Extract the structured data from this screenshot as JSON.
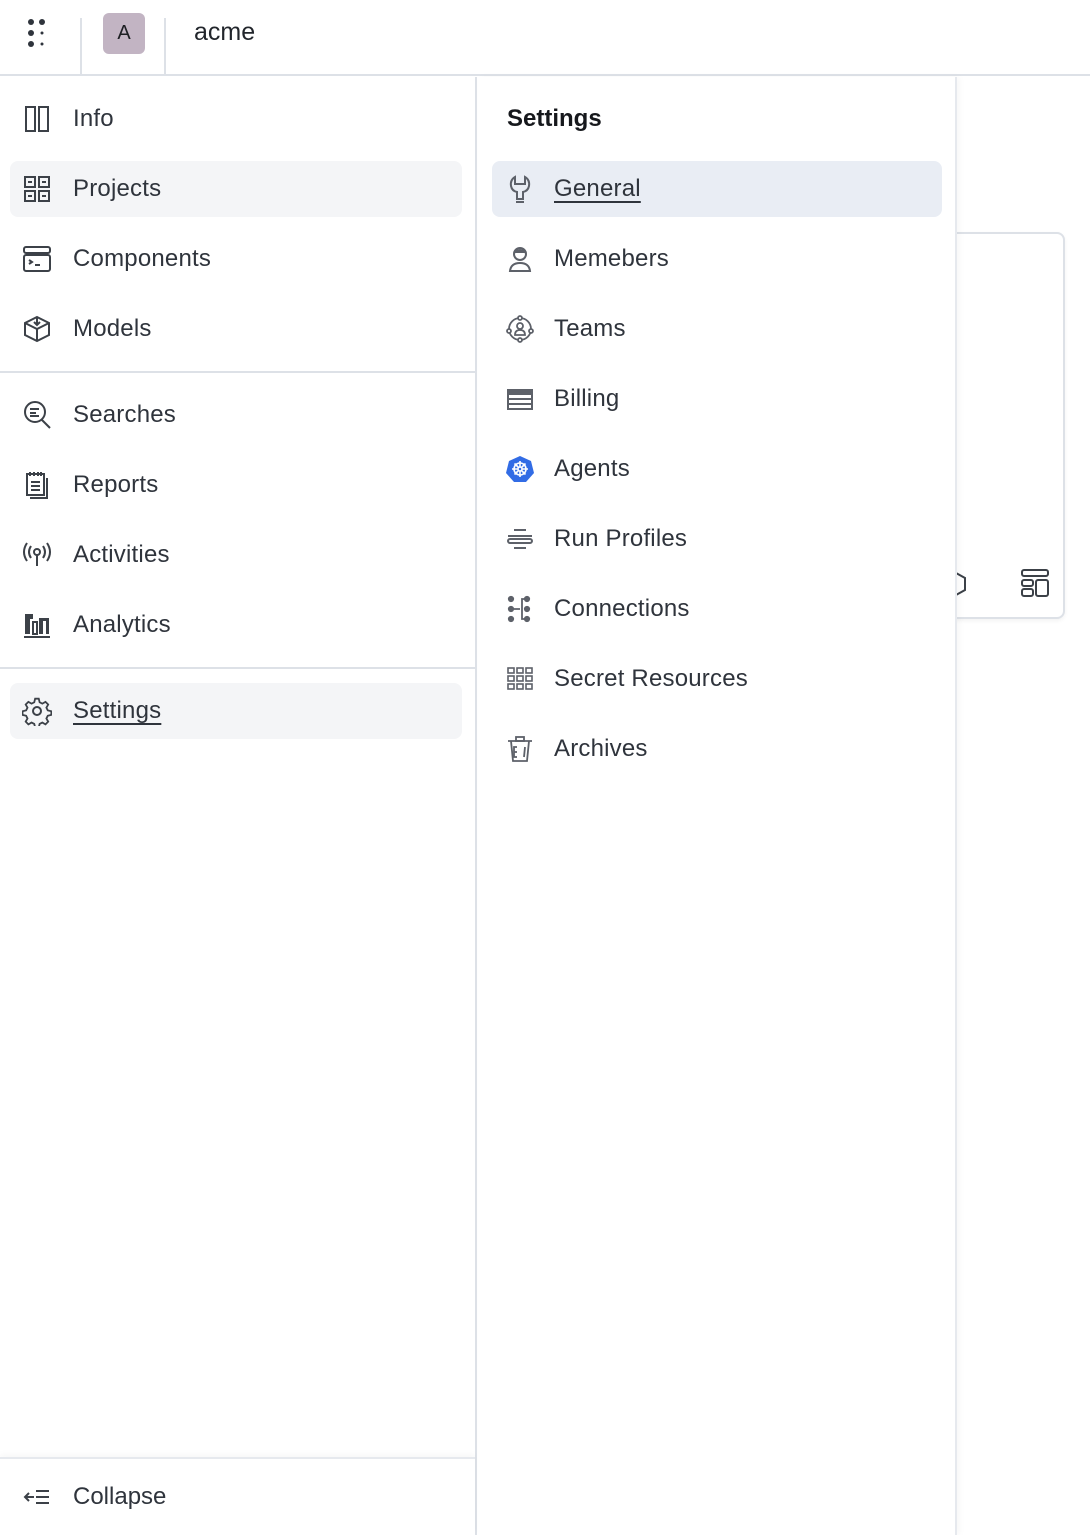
{
  "topbar": {
    "apps_icon": "grid-dots-icon",
    "org_avatar_letter": "A",
    "org_avatar_color": "#c2b4c3",
    "org_name": "acme"
  },
  "leftnav": {
    "groups": [
      [
        {
          "label": "Info",
          "icon": "panel-icon",
          "active": false
        },
        {
          "label": "Projects",
          "icon": "grid-icon",
          "active": false,
          "hover": true
        },
        {
          "label": "Components",
          "icon": "terminal-icon",
          "active": false
        },
        {
          "label": "Models",
          "icon": "box-download-icon",
          "active": false
        }
      ],
      [
        {
          "label": "Searches",
          "icon": "search-list-icon",
          "active": false
        },
        {
          "label": "Reports",
          "icon": "notepad-icon",
          "active": false
        },
        {
          "label": "Activities",
          "icon": "broadcast-icon",
          "active": false
        },
        {
          "label": "Analytics",
          "icon": "chart-bars-icon",
          "active": false
        }
      ],
      [
        {
          "label": "Settings",
          "icon": "gear-icon",
          "active": true
        }
      ]
    ],
    "collapse_label": "Collapse"
  },
  "submenu": {
    "title": "Settings",
    "items": [
      {
        "label": "General",
        "icon": "wrench-icon",
        "active": true
      },
      {
        "label": "Memebers",
        "icon": "user-icon",
        "active": false
      },
      {
        "label": "Teams",
        "icon": "team-circle-icon",
        "active": false
      },
      {
        "label": "Billing",
        "icon": "billing-table-icon",
        "active": false
      },
      {
        "label": "Agents",
        "icon": "kubernetes-helm-icon",
        "active": false,
        "icon_color": "#326ce5"
      },
      {
        "label": "Run Profiles",
        "icon": "lines-icon",
        "active": false
      },
      {
        "label": "Connections",
        "icon": "connections-icon",
        "active": false
      },
      {
        "label": "Secret Resources",
        "icon": "dot-grid-icon",
        "active": false
      },
      {
        "label": "Archives",
        "icon": "trash-icon",
        "active": false
      }
    ]
  },
  "colors": {
    "active_main_bg": "#f4f5f7",
    "active_sub_bg": "#e9edf4",
    "border": "#dde1e7",
    "text": "#2f343c"
  }
}
